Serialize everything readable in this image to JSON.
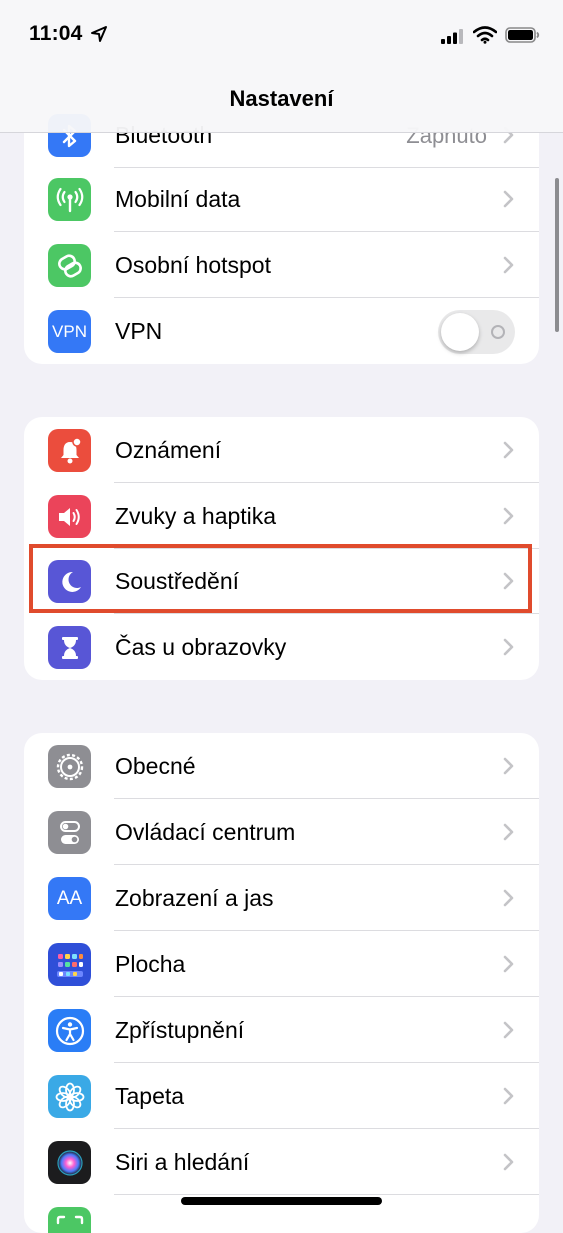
{
  "status": {
    "time": "11:04"
  },
  "nav": {
    "title": "Nastavení"
  },
  "groups": {
    "connectivity": [
      {
        "label": "Bluetooth",
        "detail": "Zapnuto",
        "icon": "bluetooth-icon",
        "color": "#3478f6"
      },
      {
        "label": "Mobilní data",
        "icon": "antenna-icon",
        "color": "#4cc764"
      },
      {
        "label": "Osobní hotspot",
        "icon": "hotspot-chain-icon",
        "color": "#4cc764"
      },
      {
        "label": "VPN",
        "icon": "vpn-icon",
        "icon_text": "VPN",
        "color": "#3478f6",
        "toggle": "off"
      }
    ],
    "notifications": [
      {
        "label": "Oznámení",
        "icon": "bell-badge-icon",
        "color": "#eb4d3d"
      },
      {
        "label": "Zvuky a haptika",
        "icon": "speaker-icon",
        "color": "#eb445a"
      },
      {
        "label": "Soustředění",
        "icon": "moon-icon",
        "color": "#5856d6"
      },
      {
        "label": "Čas u obrazovky",
        "icon": "hourglass-icon",
        "color": "#5856d6"
      }
    ],
    "general": [
      {
        "label": "Obecné",
        "icon": "gear-icon",
        "color": "#8e8e93"
      },
      {
        "label": "Ovládací centrum",
        "icon": "switches-icon",
        "color": "#8e8e93"
      },
      {
        "label": "Zobrazení a jas",
        "icon": "text-size-icon",
        "icon_text": "AA",
        "color": "#3478f6"
      },
      {
        "label": "Plocha",
        "icon": "home-grid-icon",
        "color": "#2f4fd8"
      },
      {
        "label": "Zpřístupnění",
        "icon": "accessibility-icon",
        "color": "#2a7df6"
      },
      {
        "label": "Tapeta",
        "icon": "flower-icon",
        "color": "#3aa9e6"
      },
      {
        "label": "Siri a hledání",
        "icon": "siri-icon",
        "color": "#1c1c1e"
      },
      {
        "label": "",
        "icon": "faceid-icon",
        "color": "#4cc764"
      }
    ]
  }
}
